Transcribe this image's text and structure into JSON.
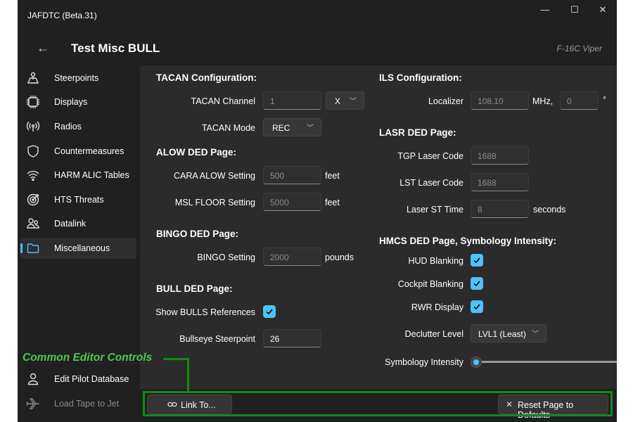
{
  "window": {
    "title": "JAFDTC (Beta.31)",
    "minimize": "—",
    "maximize": "☐",
    "close": "✕"
  },
  "header": {
    "back": "←",
    "title": "Test Misc BULL",
    "airframe": "F-16C Viper"
  },
  "nav": {
    "items": [
      {
        "label": "Steerpoints",
        "icon": "steerpoint-icon"
      },
      {
        "label": "Displays",
        "icon": "chip-icon"
      },
      {
        "label": "Radios",
        "icon": "antenna-icon"
      },
      {
        "label": "Countermeasures",
        "icon": "shield-icon"
      },
      {
        "label": "HARM ALIC Tables",
        "icon": "wifi-icon"
      },
      {
        "label": "HTS Threats",
        "icon": "target-icon"
      },
      {
        "label": "Datalink",
        "icon": "people-icon"
      },
      {
        "label": "Miscellaneous",
        "icon": "folder-icon",
        "selected": true
      }
    ],
    "footer": [
      {
        "label": "Edit Pilot Database",
        "icon": "person-icon"
      },
      {
        "label": "Load Tape to Jet",
        "icon": "airplane-icon",
        "disabled": true
      }
    ]
  },
  "tacan": {
    "title": "TACAN Configuration:",
    "channel_label": "TACAN Channel",
    "channel_placeholder": "1",
    "band": "X",
    "mode_label": "TACAN Mode",
    "mode": "REC"
  },
  "alow": {
    "title": "ALOW DED Page:",
    "cara_label": "CARA ALOW Setting",
    "cara_placeholder": "500",
    "cara_unit": "feet",
    "msl_label": "MSL FLOOR Setting",
    "msl_placeholder": "5000",
    "msl_unit": "feet"
  },
  "bingo": {
    "title": "BINGO DED Page:",
    "label": "BINGO Setting",
    "placeholder": "2000",
    "unit": "pounds"
  },
  "bull": {
    "title": "BULL DED Page:",
    "show_label": "Show BULLS References",
    "show_checked": true,
    "steerpoint_label": "Bullseye Steerpoint",
    "steerpoint_value": "26"
  },
  "ils": {
    "title": "ILS Configuration:",
    "localizer_label": "Localizer",
    "localizer_placeholder": "108.10",
    "localizer_unit": "MHz,",
    "course_placeholder": "0",
    "course_unit": "°"
  },
  "lasr": {
    "title": "LASR DED Page:",
    "tgp_label": "TGP Laser Code",
    "tgp_placeholder": "1688",
    "lst_label": "LST Laser Code",
    "lst_placeholder": "1688",
    "st_label": "Laser ST Time",
    "st_placeholder": "8",
    "st_unit": "seconds"
  },
  "hmcs": {
    "title": "HMCS DED Page, Symbology Intensity:",
    "hud_label": "HUD Blanking",
    "hud_checked": true,
    "cockpit_label": "Cockpit Blanking",
    "cockpit_checked": true,
    "rwr_label": "RWR Display",
    "rwr_checked": true,
    "declutter_label": "Declutter Level",
    "declutter": "LVL1 (Least)",
    "intensity_label": "Symbology Intensity",
    "intensity": 0
  },
  "footer": {
    "link_label": "Link To...",
    "reset_label": "Reset Page to Defaults"
  },
  "annotation": {
    "text": "Common Editor Controls"
  },
  "colors": {
    "accent": "#4cc2ff",
    "annotation": "#138a13",
    "annotation_text": "#52c552"
  }
}
